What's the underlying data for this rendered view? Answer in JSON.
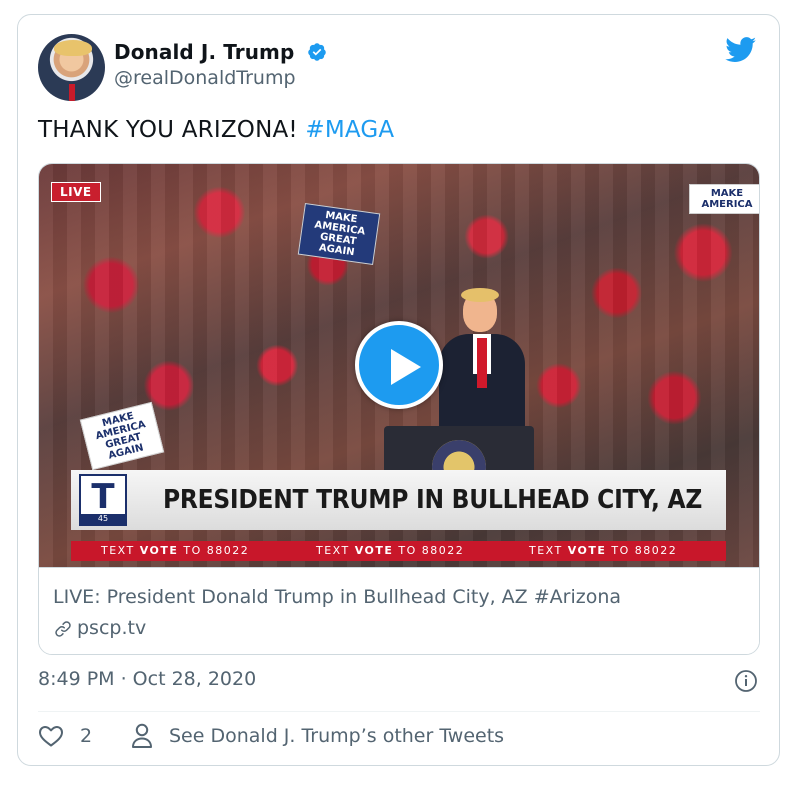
{
  "author": {
    "name": "Donald J. Trump",
    "handle": "@realDonaldTrump"
  },
  "tweet": {
    "text": "THANK YOU ARIZONA! ",
    "hashtag": "#MAGA"
  },
  "video": {
    "live_badge": "LIVE",
    "signs": [
      "MAKE AMERICA GREAT AGAIN",
      "MAKE AMERICA GREAT AGAIN",
      "MAKE AMERICA"
    ],
    "logo_letter": "T",
    "logo_number": "45",
    "headline": "PRESIDENT TRUMP IN BULLHEAD CITY, AZ",
    "ticker": [
      {
        "pre": "TEXT ",
        "bold": "VOTE",
        "post": " TO 88022"
      },
      {
        "pre": "TEXT ",
        "bold": "VOTE",
        "post": " TO 88022"
      },
      {
        "pre": "TEXT ",
        "bold": "VOTE",
        "post": " TO 88022"
      }
    ]
  },
  "media_card": {
    "title": "LIVE: President Donald Trump in Bullhead City, AZ #Arizona",
    "link": "pscp.tv"
  },
  "footer": {
    "timestamp": "8:49 PM · Oct 28, 2020",
    "like_count": "2",
    "other_tweets": "See Donald J. Trump’s other Tweets"
  },
  "colors": {
    "accent": "#1d9bf0",
    "secondary_text": "#536471",
    "border": "#cfd9de",
    "live_red": "#c91f2e"
  },
  "icons": [
    "verified-badge-icon",
    "twitter-bird-icon",
    "play-icon",
    "link-icon",
    "info-icon",
    "heart-icon",
    "person-icon"
  ]
}
